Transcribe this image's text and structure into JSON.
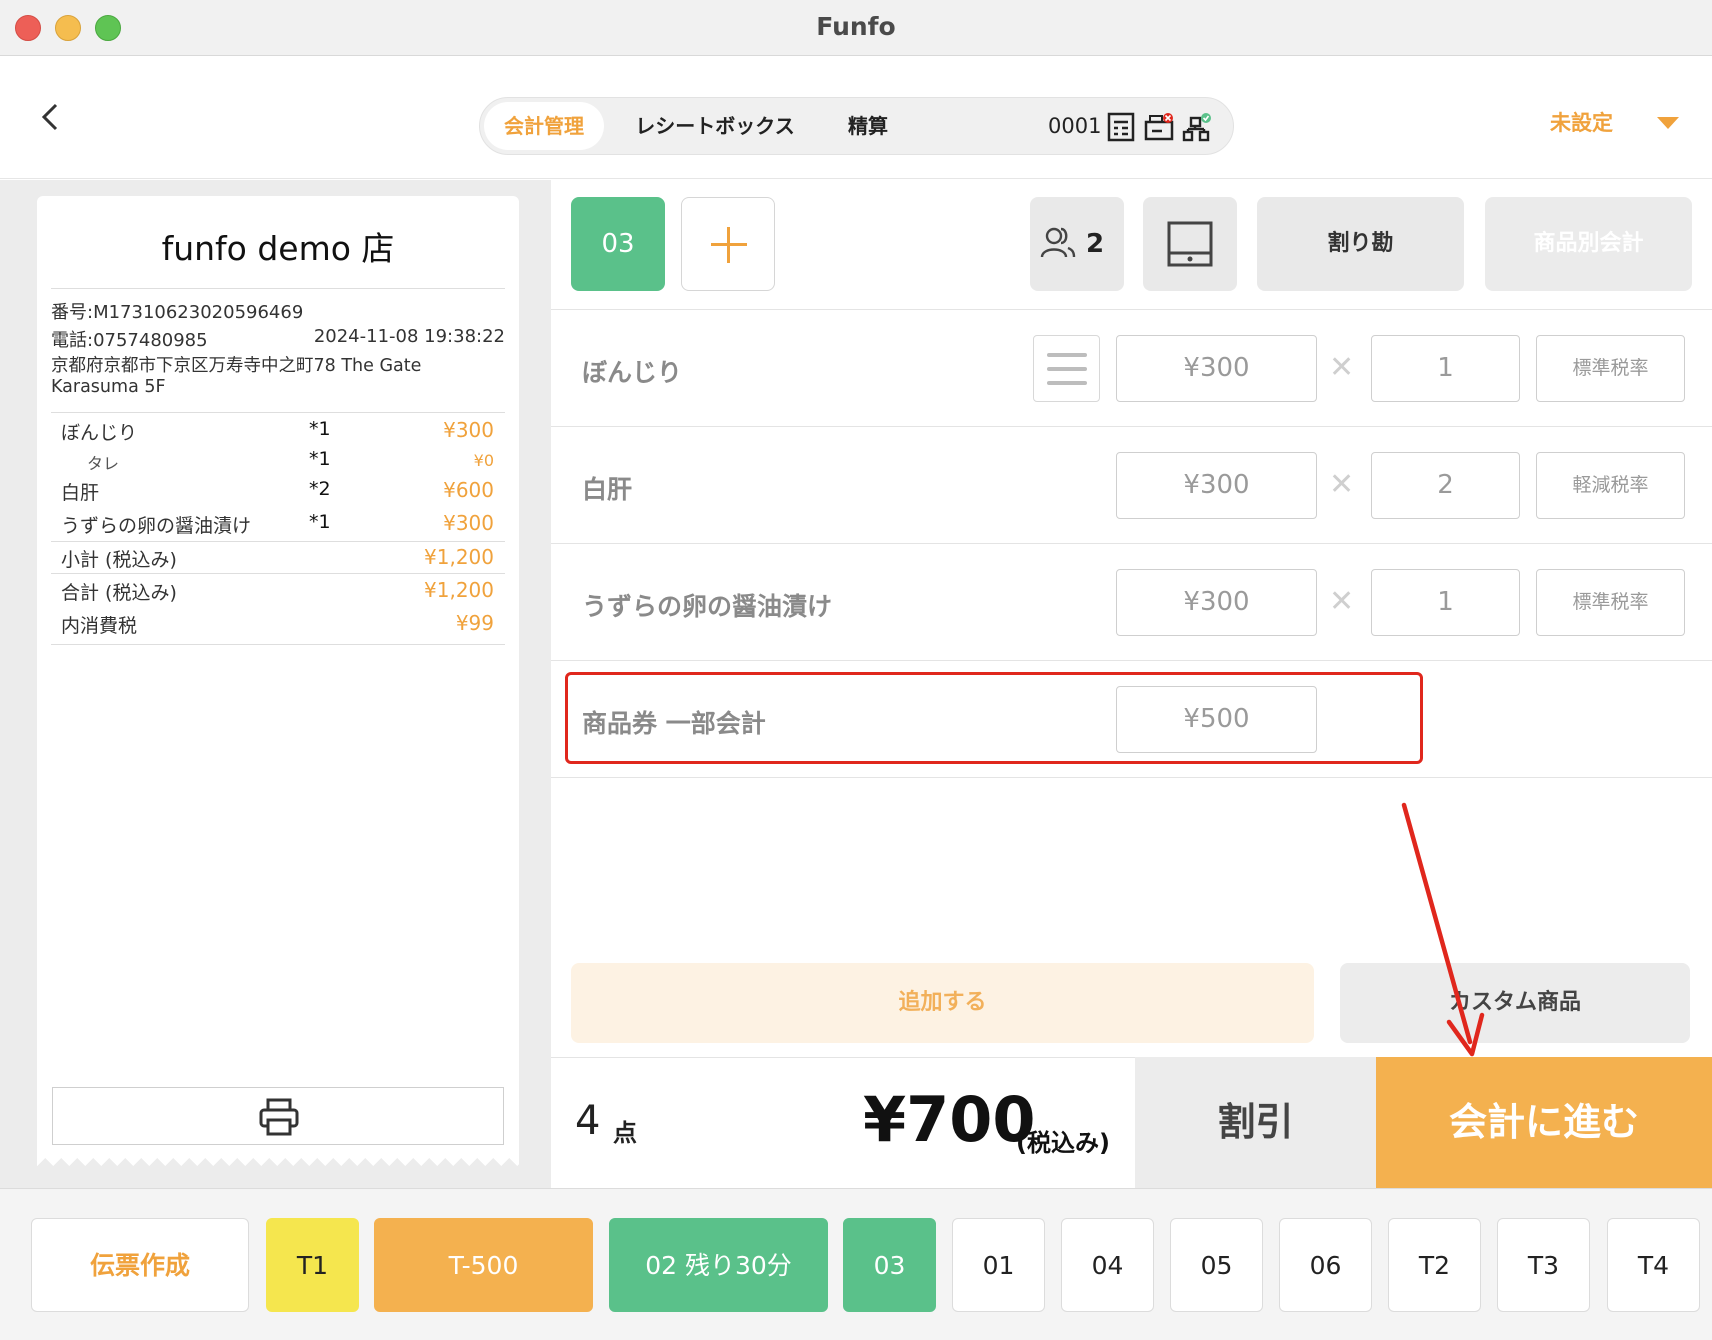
{
  "window": {
    "title": "Funfo"
  },
  "header": {
    "tabs": [
      {
        "label": "会計管理",
        "active": true
      },
      {
        "label": "レシートボックス",
        "active": false
      },
      {
        "label": "精算",
        "active": false
      }
    ],
    "device_code": "0001",
    "store_setting": "未設定"
  },
  "receipt": {
    "store_name": "funfo demo 店",
    "number": "番号:M17310623020596469",
    "phone": "電話:0757480985",
    "datetime": "2024-11-08 19:38:22",
    "address": "京都府京都市下京区万寿寺中之町78 The Gate Karasuma 5F",
    "items": [
      {
        "name": "ぼんじり",
        "qty": "*1",
        "amount": "¥300"
      },
      {
        "name": "タレ",
        "qty": "*1",
        "amount": "¥0",
        "sub": true
      },
      {
        "name": "白肝",
        "qty": "*2",
        "amount": "¥600"
      },
      {
        "name": "うずらの卵の醤油漬け",
        "qty": "*1",
        "amount": "¥300"
      }
    ],
    "subtotal_label": "小計 (税込み)",
    "subtotal": "¥1,200",
    "total_label": "合計 (税込み)",
    "total": "¥1,200",
    "tax_label": "内消費税",
    "tax": "¥99"
  },
  "order": {
    "current_tab": "03",
    "people": "2",
    "split_label": "割り勘",
    "per_item_label": "商品別会計",
    "lines": [
      {
        "name": "ぼんじり",
        "price": "¥300",
        "qty": "1",
        "tax": "標準税率"
      },
      {
        "name": "白肝",
        "price": "¥300",
        "qty": "2",
        "tax": "軽減税率"
      },
      {
        "name": "うずらの卵の醤油漬け",
        "price": "¥300",
        "qty": "1",
        "tax": "標準税率"
      },
      {
        "name": "商品券 一部会計",
        "price": "¥500"
      }
    ],
    "add_label": "追加する",
    "custom_label": "カスタム商品",
    "count": "4",
    "count_unit": "点",
    "total": "¥700",
    "total_note": "(税込み)",
    "discount_label": "割引",
    "checkout_label": "会計に進む"
  },
  "tables": {
    "ticket_label": "伝票作成",
    "items": [
      {
        "label": "T1",
        "style": "yellow"
      },
      {
        "label": "T-500",
        "style": "orange"
      },
      {
        "label": "02 残り30分",
        "style": "green"
      },
      {
        "label": "03",
        "style": "green"
      },
      {
        "label": "01",
        "style": "plain"
      },
      {
        "label": "04",
        "style": "plain"
      },
      {
        "label": "05",
        "style": "plain"
      },
      {
        "label": "06",
        "style": "plain"
      },
      {
        "label": "T2",
        "style": "plain"
      },
      {
        "label": "T3",
        "style": "plain"
      },
      {
        "label": "T4",
        "style": "plain"
      }
    ]
  },
  "colors": {
    "accent": "#f0a23c",
    "green": "#5ac18a",
    "highlight": "#e0271d"
  }
}
